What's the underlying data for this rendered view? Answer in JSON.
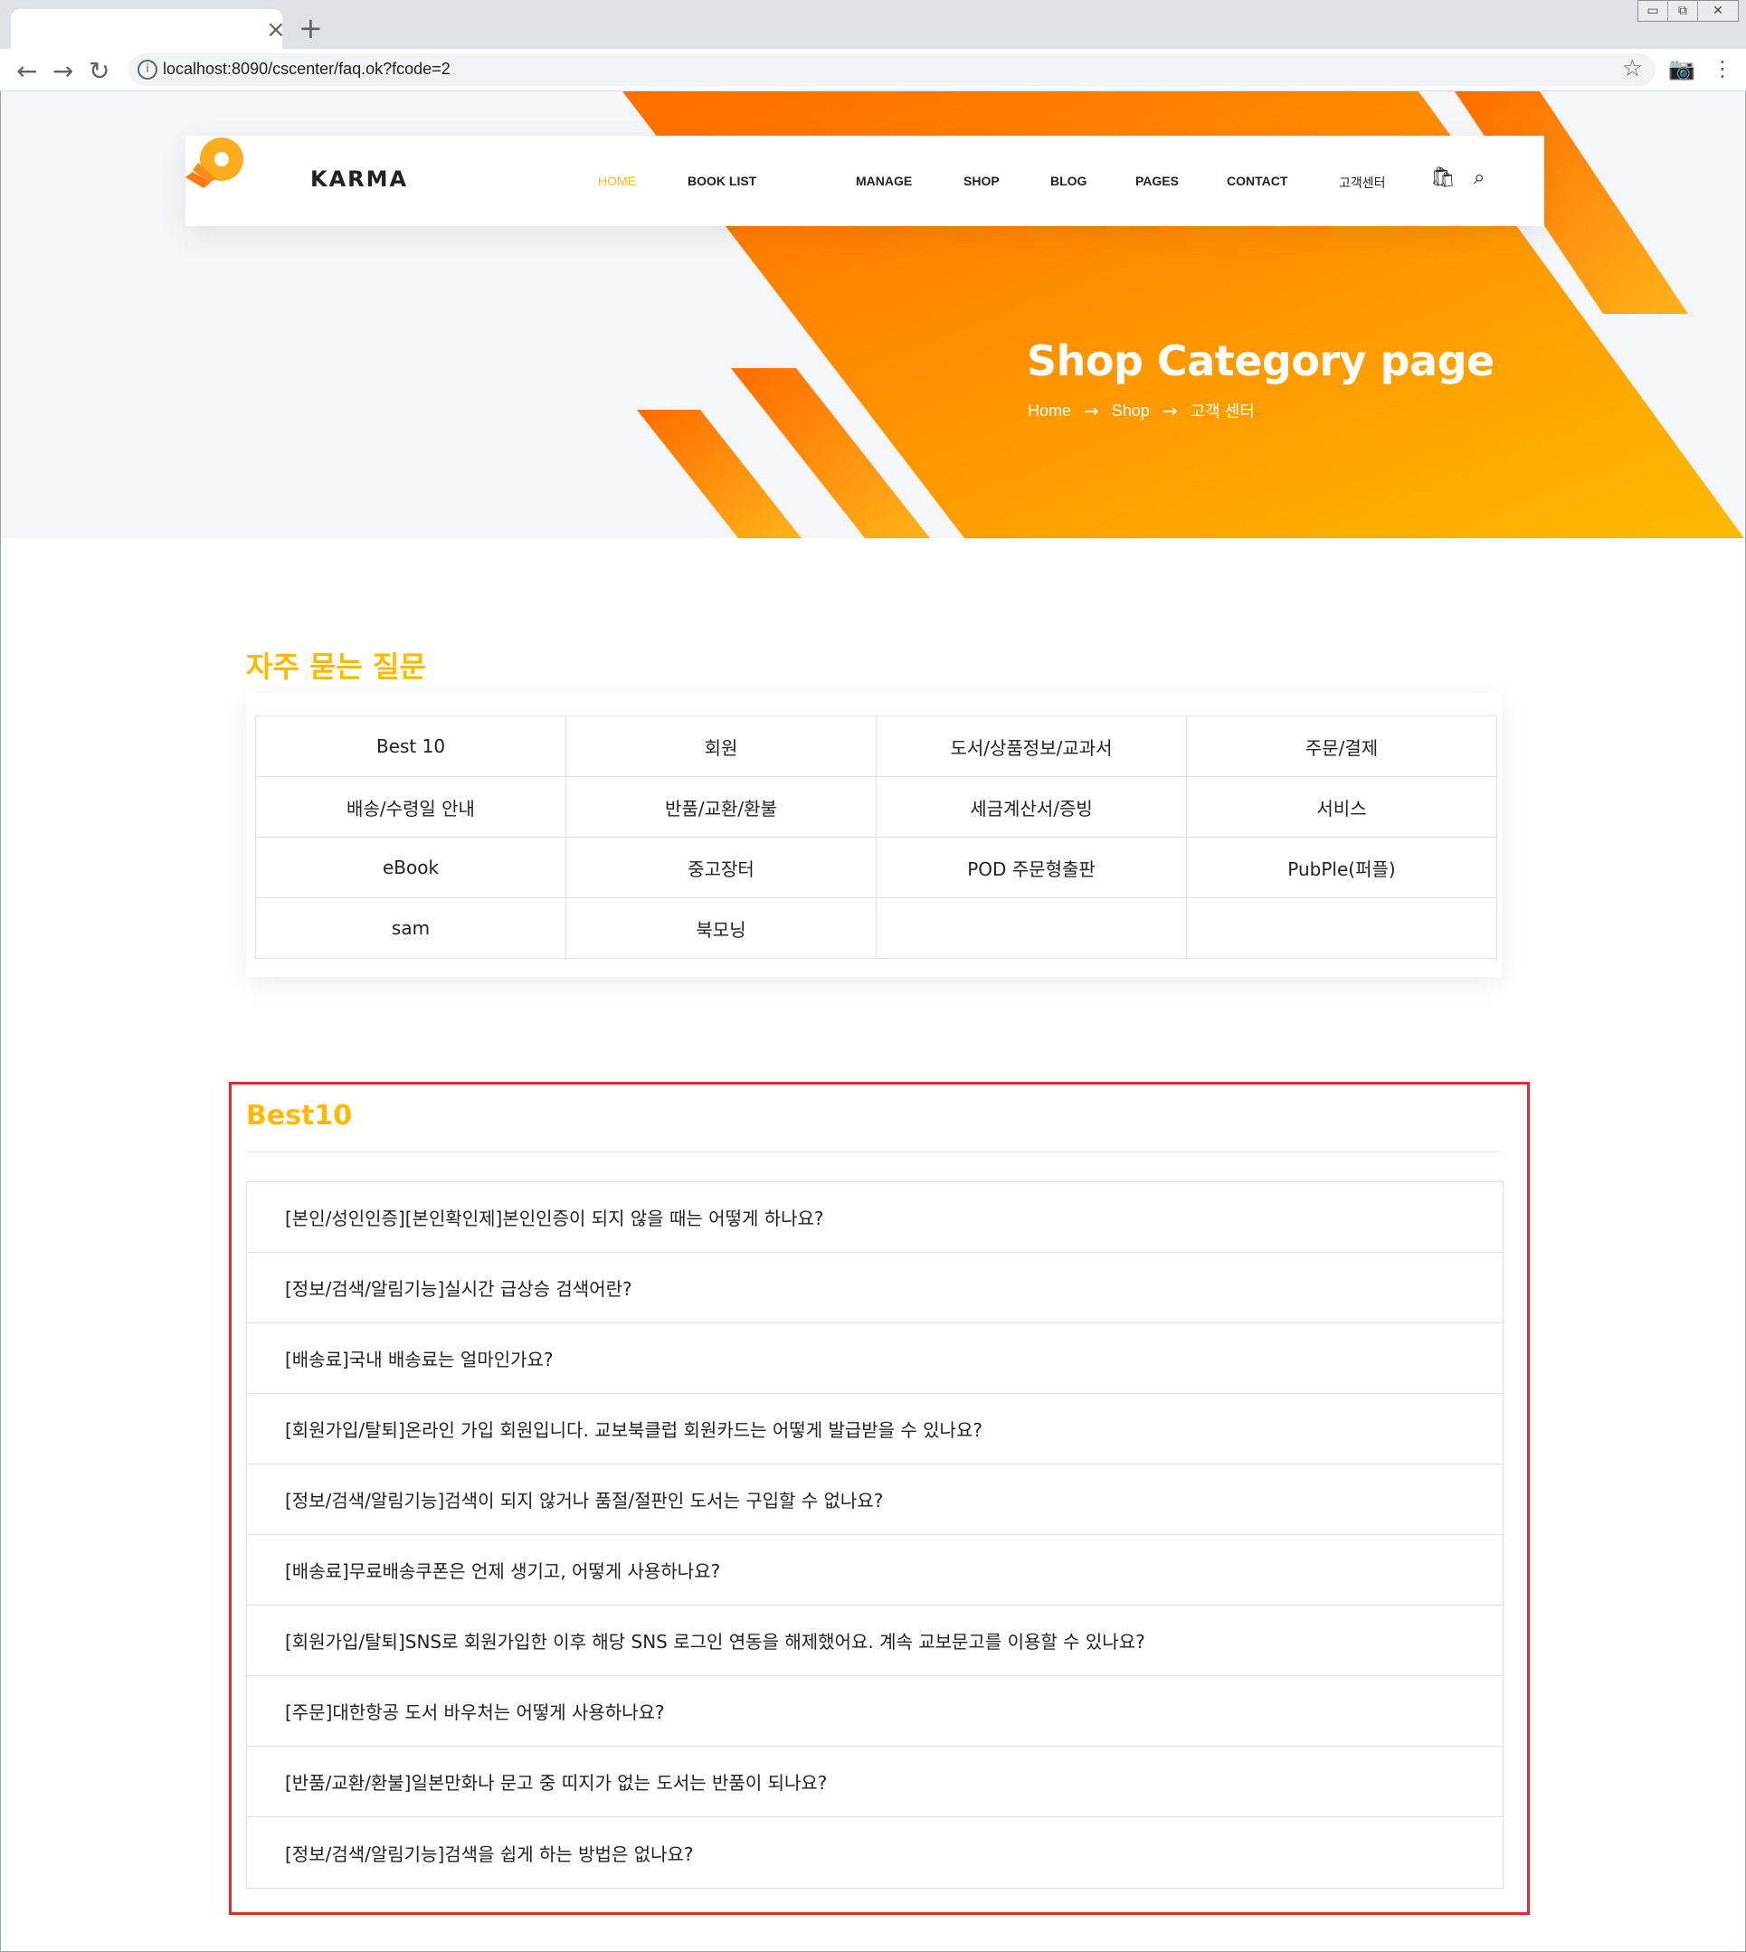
{
  "browser": {
    "url": "localhost:8090/cscenter/faq.ok?fcode=2",
    "close_glyph": "×",
    "newtab_glyph": "+",
    "back_glyph": "←",
    "forward_glyph": "→",
    "reload_glyph": "↻",
    "info_glyph": "i",
    "star_glyph": "☆",
    "camera_glyph": "📷",
    "menu_glyph": "⋮",
    "win": {
      "minimize": "▭",
      "restore": "⧉",
      "close": "✕"
    }
  },
  "header": {
    "logo_text": "KARMA",
    "menu": [
      {
        "label": "HOME",
        "active": true
      },
      {
        "label": "BOOK LIST"
      },
      {
        "label": "MANAGE"
      },
      {
        "label": "SHOP"
      },
      {
        "label": "BLOG"
      },
      {
        "label": "PAGES"
      },
      {
        "label": "CONTACT"
      },
      {
        "label": "고객센터"
      }
    ],
    "icons": {
      "cart": "🛍",
      "search": "⌕"
    }
  },
  "banner": {
    "title": "Shop Category page",
    "breadcrumb": [
      "Home",
      "Shop",
      "고객 센터"
    ],
    "arrow": "→"
  },
  "faq": {
    "heading": "자주 묻는 질문",
    "categories": [
      [
        "Best 10",
        "회원",
        "도서/상품정보/교과서",
        "주문/결제"
      ],
      [
        "배송/수령일 안내",
        "반품/교환/환불",
        "세금계산서/증빙",
        "서비스"
      ],
      [
        "eBook",
        "중고장터",
        "POD 주문형출판",
        "PubPle(퍼플)"
      ],
      [
        "sam",
        "북모닝",
        "",
        ""
      ]
    ]
  },
  "best10": {
    "title": "Best10",
    "items": [
      "[본인/성인인증][본인확인제]본인인증이 되지 않을 때는 어떻게 하나요?",
      "[정보/검색/알림기능]실시간 급상승 검색어란?",
      "[배송료]국내 배송료는 얼마인가요?",
      "[회원가입/탈퇴]온라인 가입 회원입니다. 교보북클럽 회원카드는 어떻게 발급받을 수 있나요?",
      "[정보/검색/알림기능]검색이 되지 않거나 품절/절판인 도서는 구입할 수 없나요?",
      "[배송료]무료배송쿠폰은 언제 생기고, 어떻게 사용하나요?",
      "[회원가입/탈퇴]SNS로 회원가입한 이후 해당 SNS 로그인 연동을 해제했어요. 계속 교보문고를 이용할 수 있나요?",
      "[주문]대한항공 도서 바우처는 어떻게 사용하나요?",
      "[반품/교환/환불]일본만화나 문고 중 띠지가 없는 도서는 반품이 되나요?",
      "[정보/검색/알림기능]검색을 쉽게 하는 방법은 없나요?"
    ]
  },
  "colors": {
    "accent": "#ffba00",
    "banner_orange": "#ff6c00",
    "highlight_frame": "#e3292d"
  }
}
